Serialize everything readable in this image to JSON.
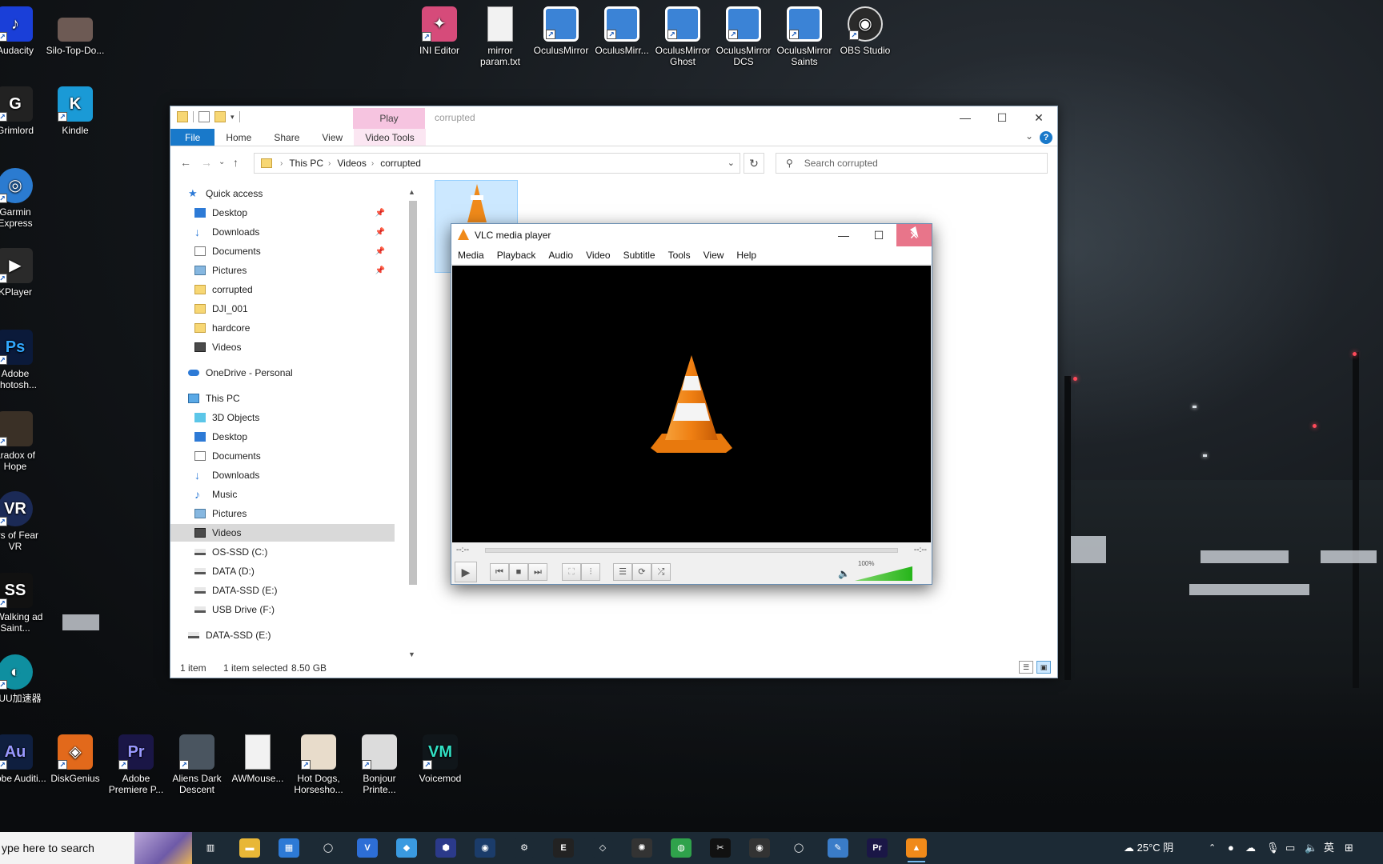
{
  "desktop": {
    "icons": [
      {
        "label": "Audacity",
        "icon": "audacity-icon",
        "color": "#1a3fd8"
      },
      {
        "label": "Silo-Top-Do...",
        "icon": "image-file-icon",
        "color": "#6d5a54"
      },
      {
        "label": "Grimlord",
        "icon": "grimlord-icon",
        "color": "#222222"
      },
      {
        "label": "Kindle",
        "icon": "kindle-icon",
        "color": "#1a9ad6"
      },
      {
        "label": "Garmin Express",
        "icon": "garmin-icon",
        "color": "#2b7bd0"
      },
      {
        "label": "KPlayer",
        "icon": "kmplayer-icon",
        "color": "#2a2a2a"
      },
      {
        "label": "Adobe Photosh...",
        "icon": "photoshop-icon",
        "color": "#0b1a3a"
      },
      {
        "label": "aradox of Hope",
        "icon": "game-icon",
        "color": "#3a3026"
      },
      {
        "label": "ers of Fear VR",
        "icon": "vr-game-icon",
        "color": "#1b2a56"
      },
      {
        "label": "e Walking ad Saint...",
        "icon": "walking-dead-icon",
        "color": "#111111"
      },
      {
        "label": "易UU加速器",
        "icon": "uu-accelerator-icon",
        "color": "#0f8fa0"
      },
      {
        "label": "INI Editor",
        "icon": "ini-editor-icon",
        "color": "#d64b7a"
      },
      {
        "label": "mirror param.txt",
        "icon": "text-file-icon",
        "color": "#f2f2f2"
      },
      {
        "label": "OculusMirror",
        "icon": "oculus-mirror-icon",
        "color": "#3b83d6"
      },
      {
        "label": "OculusMirr...",
        "icon": "oculus-mirror-icon",
        "color": "#3b83d6"
      },
      {
        "label": "OculusMirror Ghost",
        "icon": "oculus-mirror-icon",
        "color": "#3b83d6"
      },
      {
        "label": "OculusMirror DCS",
        "icon": "oculus-mirror-icon",
        "color": "#3b83d6"
      },
      {
        "label": "OculusMirror Saints",
        "icon": "oculus-mirror-icon",
        "color": "#3b83d6"
      },
      {
        "label": "OBS Studio",
        "icon": "obs-icon",
        "color": "#2a2a2a"
      },
      {
        "label": "Adobe Auditi...",
        "icon": "audition-icon",
        "color": "#0f1f3f"
      },
      {
        "label": "DiskGenius",
        "icon": "diskgenius-icon",
        "color": "#e2691b"
      },
      {
        "label": "Adobe Premiere P...",
        "icon": "premiere-icon",
        "color": "#1a1646"
      },
      {
        "label": "Aliens Dark Descent",
        "icon": "aliens-game-icon",
        "color": "#4a5560"
      },
      {
        "label": "AWMouse...",
        "icon": "text-file-icon",
        "color": "#f2f2f2"
      },
      {
        "label": "Hot Dogs, Horsesho...",
        "icon": "hot-dogs-game-icon",
        "color": "#e8dccb"
      },
      {
        "label": "Bonjour Printe...",
        "icon": "printer-icon",
        "color": "#dcdcdc"
      },
      {
        "label": "Voicemod",
        "icon": "voicemod-icon",
        "color": "#10161a"
      }
    ]
  },
  "explorer": {
    "play_tab": "Play",
    "title": "corrupted",
    "tabs": [
      "File",
      "Home",
      "Share",
      "View",
      "Video Tools"
    ],
    "breadcrumb": [
      "This PC",
      "Videos",
      "corrupted"
    ],
    "search_placeholder": "Search corrupted",
    "nav": {
      "quick_access": "Quick access",
      "quick_items": [
        "Desktop",
        "Downloads",
        "Documents",
        "Pictures",
        "corrupted",
        "DJI_001",
        "hardcore",
        "Videos"
      ],
      "onedrive": "OneDrive - Personal",
      "this_pc": "This PC",
      "pc_items": [
        "3D Objects",
        "Desktop",
        "Documents",
        "Downloads",
        "Music",
        "Pictures",
        "Videos",
        "OS-SSD (C:)",
        "DATA (D:)",
        "DATA-SSD (E:)",
        "USB Drive (F:)"
      ],
      "extra_drive": "DATA-SSD (E:)",
      "selected": "Videos"
    },
    "status": {
      "items": "1 item",
      "selected": "1 item selected",
      "size": "8.50 GB"
    }
  },
  "vlc": {
    "title": "VLC media player",
    "menu": [
      "Media",
      "Playback",
      "Audio",
      "Video",
      "Subtitle",
      "Tools",
      "View",
      "Help"
    ],
    "elapsed": "--:--",
    "remaining": "--:--",
    "volume_label": "100%",
    "volume_level": 1.0
  },
  "taskbar": {
    "search_placeholder": "ype here to search",
    "weather": "25°C 阴",
    "ime": "英",
    "apps": [
      {
        "icon": "task-view-icon",
        "color": "#1c2a35"
      },
      {
        "icon": "file-explorer-icon",
        "color": "#e8b737"
      },
      {
        "icon": "microsoft-store-icon",
        "color": "#2d7ad6"
      },
      {
        "icon": "oculus-icon",
        "color": "#1c2a35"
      },
      {
        "icon": "vivaldi-icon",
        "color": "#2d6ed6"
      },
      {
        "icon": "app-icon",
        "color": "#3a9ae0"
      },
      {
        "icon": "shield-app-icon",
        "color": "#2b3a8a"
      },
      {
        "icon": "steam-icon",
        "color": "#1b3c6a"
      },
      {
        "icon": "settings-icon",
        "color": "#1c2a35"
      },
      {
        "icon": "epic-games-icon",
        "color": "#222222"
      },
      {
        "icon": "unity-icon",
        "color": "#1c2a35"
      },
      {
        "icon": "davinci-icon",
        "color": "#333333"
      },
      {
        "icon": "chrome-icon",
        "color": "#2fa24b"
      },
      {
        "icon": "capcut-icon",
        "color": "#111111"
      },
      {
        "icon": "obs-icon",
        "color": "#333333"
      },
      {
        "icon": "oculus-icon",
        "color": "#1c2a35"
      },
      {
        "icon": "snipping-tool-icon",
        "color": "#3a7cc8"
      },
      {
        "icon": "premiere-icon",
        "color": "#1a1646"
      },
      {
        "icon": "vlc-icon",
        "color": "#f08a1a"
      }
    ]
  }
}
